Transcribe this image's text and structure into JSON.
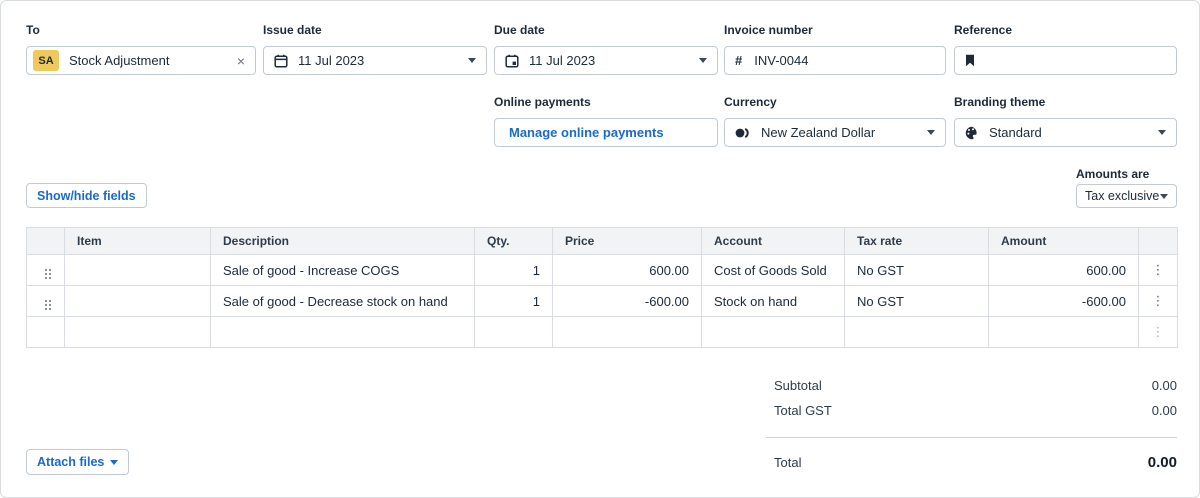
{
  "colors": {
    "accent_blue": "#1b6ac9",
    "badge_yellow": "#f0c95c",
    "text_dark": "#1e2a38",
    "table_header_bg": "#f2f3f5",
    "border_gray": "#c3cad1"
  },
  "fields": {
    "to": {
      "label": "To",
      "badge": "SA",
      "value": "Stock Adjustment",
      "close_glyph": "×"
    },
    "issue_date": {
      "label": "Issue date",
      "value": "11 Jul 2023"
    },
    "due_date": {
      "label": "Due date",
      "value": "11 Jul 2023"
    },
    "invoice_number": {
      "label": "Invoice number",
      "prefix": "#",
      "value": "INV-0044"
    },
    "reference": {
      "label": "Reference",
      "value": ""
    },
    "online_payments": {
      "label": "Online payments",
      "button_label": "Manage online payments"
    },
    "currency": {
      "label": "Currency",
      "value": "New Zealand Dollar"
    },
    "branding_theme": {
      "label": "Branding theme",
      "value": "Standard"
    }
  },
  "toolbar": {
    "show_hide_label": "Show/hide fields",
    "amounts_are_label": "Amounts are",
    "amounts_are_value": "Tax exclusive"
  },
  "table": {
    "headers": {
      "item": "Item",
      "description": "Description",
      "qty": "Qty.",
      "price": "Price",
      "account": "Account",
      "tax_rate": "Tax rate",
      "amount": "Amount"
    },
    "rows": [
      {
        "item": "",
        "description": "Sale of good - Increase COGS",
        "qty": "1",
        "price": "600.00",
        "account": "Cost of Goods Sold",
        "tax_rate": "No GST",
        "amount": "600.00"
      },
      {
        "item": "",
        "description": "Sale of good - Decrease stock on hand",
        "qty": "1",
        "price": "-600.00",
        "account": "Stock on hand",
        "tax_rate": "No GST",
        "amount": "-600.00"
      },
      {
        "item": "",
        "description": "",
        "qty": "",
        "price": "",
        "account": "",
        "tax_rate": "",
        "amount": ""
      }
    ]
  },
  "totals": {
    "subtotal_label": "Subtotal",
    "subtotal_value": "0.00",
    "total_gst_label": "Total GST",
    "total_gst_value": "0.00",
    "total_label": "Total",
    "total_value": "0.00"
  },
  "footer": {
    "attach_files_label": "Attach files"
  },
  "icons": {
    "kebab": "⋮"
  }
}
